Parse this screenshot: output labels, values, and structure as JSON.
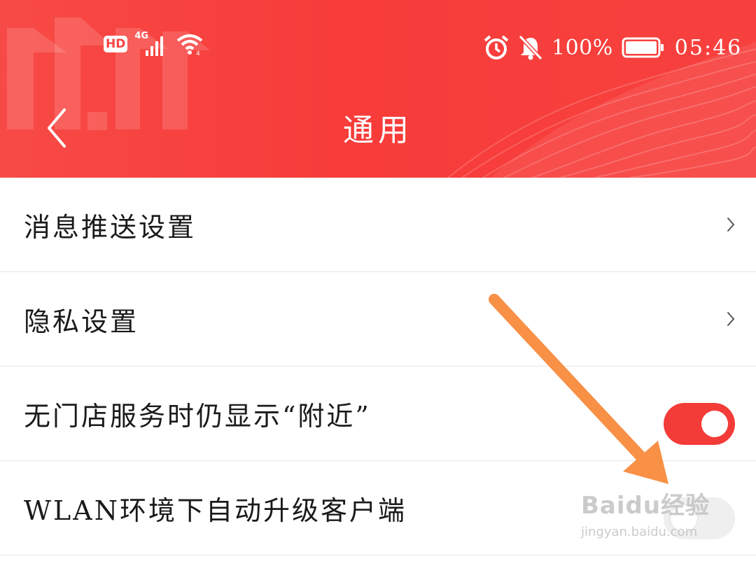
{
  "status_bar": {
    "hd_label": "HD",
    "network_label": "4G",
    "battery_percent": "100%",
    "time": "05:46",
    "icons": [
      "signal-icon",
      "wifi-icon",
      "alarm-icon",
      "bell-off-icon",
      "battery-icon"
    ]
  },
  "header": {
    "title": "通用",
    "back_icon": "chevron-left-icon",
    "accent_color": "#f74442"
  },
  "settings": {
    "items": [
      {
        "label": "消息推送设置",
        "control": "chevron"
      },
      {
        "label": "隐私设置",
        "control": "chevron"
      },
      {
        "label": "无门店服务时仍显示“附近”",
        "control": "toggle",
        "on": true
      },
      {
        "label": "WLAN环境下自动升级客户端",
        "control": "toggle",
        "on": false
      }
    ]
  },
  "toggle_on_color": "#f33b37",
  "annotation": {
    "arrow_color": "#f89046",
    "icon": "arrow-down-right-icon"
  },
  "watermark": {
    "main": "Baidu经验",
    "sub": "jingyan.baidu.com"
  }
}
